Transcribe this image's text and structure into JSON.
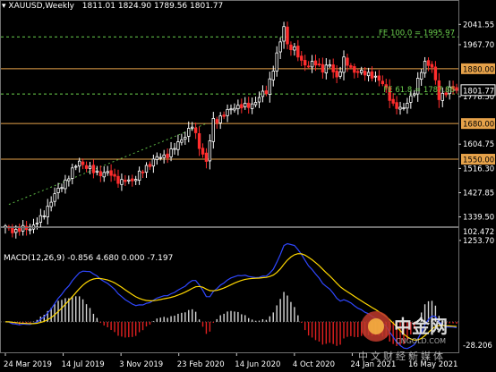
{
  "header": {
    "symbol_label": "XAUUSD,Weekly",
    "ohlc_label": "1811.01 1824.90 1789.56 1801.77"
  },
  "macd": {
    "label": "MACD(12,26,9) -0.856 4.680 0.000 -7.197",
    "y_ticks": [
      "102.472",
      "-28.206"
    ]
  },
  "watermark": {
    "brand": "中金网",
    "domain": "CNGOLD.COM",
    "slogan": "中文财经新媒体"
  },
  "colors": {
    "background": "#000000",
    "grid": "#393939",
    "bull": "#ffffff",
    "bear": "#ff2d2d",
    "level": "#e6a24a",
    "fib": "#6bcf4e",
    "trend": "#5dba45",
    "macd_line": "#2f47ff",
    "signal_line": "#ffd700",
    "hist_pos": "#d7d7d7",
    "hist_neg": "#e02020",
    "price_box": "#000000"
  },
  "chart_data": {
    "type": "candlestick",
    "timeframe": "Weekly",
    "symbol": "XAUUSD",
    "x_tick_labels": [
      "24 Mar 2019",
      "14 Jul 2019",
      "3 Nov 2019",
      "23 Feb 2020",
      "14 Jun 2020",
      "4 Oct 2020",
      "24 Jan 2021",
      "16 May 2021"
    ],
    "y_ticks": [
      2041.55,
      1967.7,
      1778.5,
      1604.75,
      1516.3,
      1427.85,
      1339.5,
      1253.7
    ],
    "y_tick_labels": [
      "2041.55",
      "1967.70",
      "1778.50",
      "1604.75",
      "1516.30",
      "1427.85",
      "1339.50",
      "1253.70"
    ],
    "ylim": [
      1250,
      2085
    ],
    "last": {
      "open": 1811.01,
      "high": 1824.9,
      "low": 1789.56,
      "close": 1801.77,
      "label": "1801.77"
    },
    "horizontal_levels": [
      {
        "value": 1880.0,
        "label": "1880.00"
      },
      {
        "value": 1680.0,
        "label": "1680.00"
      },
      {
        "value": 1550.0,
        "label": "1550.00"
      }
    ],
    "fib_levels": [
      {
        "value": 1995.97,
        "label": "FE 100.0 = 1995.97"
      },
      {
        "value": 1787.86,
        "label": "FE 61.8 = 1787.86"
      }
    ],
    "trendline": {
      "start": [
        1,
        1385
      ],
      "end": [
        57,
        1680
      ]
    },
    "price_anchors": [
      [
        0,
        1300
      ],
      [
        3,
        1290
      ],
      [
        7,
        1300
      ],
      [
        10,
        1330
      ],
      [
        13,
        1400
      ],
      [
        16,
        1455
      ],
      [
        19,
        1505
      ],
      [
        21,
        1545
      ],
      [
        24,
        1510
      ],
      [
        27,
        1500
      ],
      [
        30,
        1495
      ],
      [
        33,
        1465
      ],
      [
        36,
        1475
      ],
      [
        39,
        1505
      ],
      [
        42,
        1550
      ],
      [
        45,
        1560
      ],
      [
        48,
        1590
      ],
      [
        51,
        1640
      ],
      [
        53,
        1670
      ],
      [
        55,
        1600
      ],
      [
        57,
        1540
      ],
      [
        59,
        1690
      ],
      [
        62,
        1710
      ],
      [
        65,
        1745
      ],
      [
        68,
        1740
      ],
      [
        71,
        1760
      ],
      [
        74,
        1800
      ],
      [
        76,
        1880
      ],
      [
        78,
        1975
      ],
      [
        79,
        2040
      ],
      [
        80,
        1970
      ],
      [
        82,
        1945
      ],
      [
        84,
        1910
      ],
      [
        86,
        1890
      ],
      [
        88,
        1900
      ],
      [
        90,
        1880
      ],
      [
        92,
        1890
      ],
      [
        94,
        1850
      ],
      [
        96,
        1910
      ],
      [
        98,
        1880
      ],
      [
        100,
        1870
      ],
      [
        102,
        1860
      ],
      [
        104,
        1860
      ],
      [
        106,
        1835
      ],
      [
        108,
        1810
      ],
      [
        110,
        1745
      ],
      [
        112,
        1730
      ],
      [
        114,
        1760
      ],
      [
        116,
        1790
      ],
      [
        117,
        1835
      ],
      [
        118,
        1880
      ],
      [
        119,
        1905
      ],
      [
        121,
        1880
      ],
      [
        122,
        1835
      ],
      [
        123,
        1780
      ],
      [
        125,
        1790
      ],
      [
        127,
        1812
      ],
      [
        128,
        1801.77
      ]
    ],
    "macd_ylim": [
      -30,
      105
    ]
  }
}
